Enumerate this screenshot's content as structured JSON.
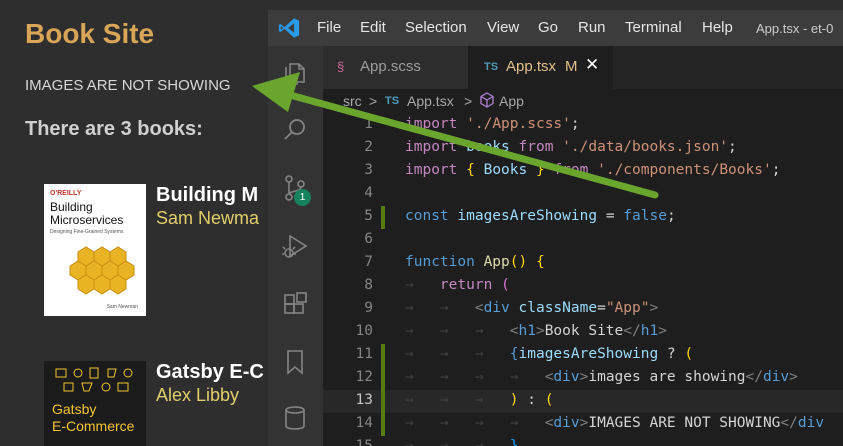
{
  "site": {
    "title": "Book Site",
    "notice": "IMAGES ARE NOT SHOWING",
    "count_text": "There are 3 books:",
    "books": [
      {
        "title": "Building M",
        "author": "Sam Newma",
        "cover": {
          "publisher": "O'REILLY",
          "title_line1": "Building",
          "title_line2": "Microservices",
          "subtitle": "Designing Fine-Grained Systems",
          "author": "Sam Newman"
        }
      },
      {
        "title": "Gatsby E-C",
        "author": "Alex Libby",
        "cover": {
          "title_line1": "Gatsby",
          "title_line2": "E-Commerce"
        }
      }
    ]
  },
  "vscode": {
    "menu": [
      "File",
      "Edit",
      "Selection",
      "View",
      "Go",
      "Run",
      "Terminal",
      "Help"
    ],
    "window_title": "App.tsx - et-0",
    "activity_badge": "1",
    "tabs": [
      {
        "icon": "sass-icon",
        "label": "App.scss",
        "active": false
      },
      {
        "icon": "TS",
        "label": "App.tsx",
        "modified": "M",
        "close": "✕",
        "active": true
      }
    ],
    "breadcrumb": {
      "folder": "src",
      "sep": ">",
      "file_icon": "TS",
      "file": "App.tsx",
      "symbol": "App"
    },
    "lines": [
      {
        "n": "1",
        "modified": false
      },
      {
        "n": "2",
        "modified": false
      },
      {
        "n": "3",
        "modified": false
      },
      {
        "n": "4",
        "modified": false
      },
      {
        "n": "5",
        "modified": true
      },
      {
        "n": "6",
        "modified": false
      },
      {
        "n": "7",
        "modified": false
      },
      {
        "n": "8",
        "modified": false
      },
      {
        "n": "9",
        "modified": false
      },
      {
        "n": "10",
        "modified": false
      },
      {
        "n": "11",
        "modified": true
      },
      {
        "n": "12",
        "modified": true
      },
      {
        "n": "13",
        "modified": true,
        "current": true
      },
      {
        "n": "14",
        "modified": true
      },
      {
        "n": "15",
        "modified": false
      }
    ],
    "code": {
      "l1": {
        "kw": "import",
        "str": "'./App.scss'",
        "end": ";"
      },
      "l2": {
        "kw": "import",
        "id": "books",
        "from": "from",
        "str": "'./data/books.json'",
        "end": ";"
      },
      "l3": {
        "kw": "import",
        "open": "{",
        "id": "Books",
        "close": "}",
        "from": "from",
        "str": "'./components/Books'",
        "end": ";"
      },
      "l5": {
        "kw": "const",
        "id": "imagesAreShowing",
        "op": "=",
        "val": "false",
        "end": ";"
      },
      "l7": {
        "kw": "function",
        "fn": "App",
        "paren": "()",
        "brace": "{"
      },
      "l8": {
        "kw": "return",
        "paren": "("
      },
      "l9": {
        "lt": "<",
        "tag": "div",
        "attr": "className",
        "eq": "=",
        "str": "\"App\"",
        "gt": ">"
      },
      "l10": {
        "lt": "<",
        "tag": "h1",
        "gt": ">",
        "text": "Book Site",
        "clt": "</",
        "ctag": "h1",
        "cgt": ">"
      },
      "l11": {
        "open": "{",
        "id": "imagesAreShowing",
        "op": "?",
        "paren": "("
      },
      "l12": {
        "lt": "<",
        "tag": "div",
        "gt": ">",
        "text": "images are showing",
        "clt": "</",
        "ctag": "div",
        "cgt": ">"
      },
      "l13": {
        "paren": ")",
        "op": ":",
        "paren2": "("
      },
      "l14": {
        "lt": "<",
        "tag": "div",
        "gt": ">",
        "text": "IMAGES ARE NOT SHOWING",
        "clt": "</",
        "ctag": "div"
      },
      "l15": {
        "brace": "}"
      }
    }
  },
  "colors": {
    "arrow": "#6aa52e",
    "site_title": "#d9a557",
    "author": "#e2cf6a",
    "git_modified": "#587c0c"
  }
}
